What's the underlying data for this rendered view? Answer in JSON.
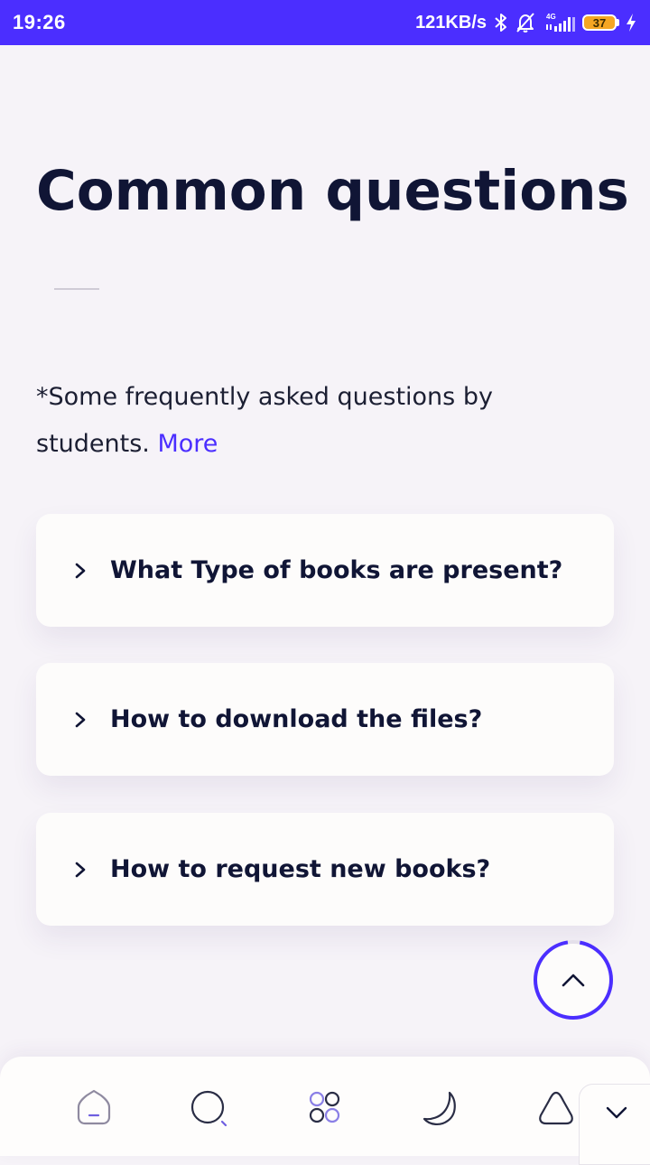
{
  "status_bar": {
    "time": "19:26",
    "network_speed": "121KB/s",
    "network_type": "4G",
    "battery_level": "37",
    "icons": [
      "bluetooth-icon",
      "bell-off-icon",
      "signal-icon",
      "battery-icon",
      "charging-icon"
    ],
    "background_color": "#4b2eff"
  },
  "page": {
    "title": "Common questions",
    "intro_text": "*Some frequently asked questions by students.",
    "more_link": "More"
  },
  "faq": [
    {
      "question": "What Type of books are present?"
    },
    {
      "question": "How to download the files?"
    },
    {
      "question": "How to request new books?"
    }
  ],
  "bottom_nav": {
    "items": [
      "home-icon",
      "search-icon",
      "apps-icon",
      "moon-icon",
      "triangle-icon"
    ],
    "collapse_icon": "chevron-down-icon"
  },
  "accent_color": "#4b2eff"
}
